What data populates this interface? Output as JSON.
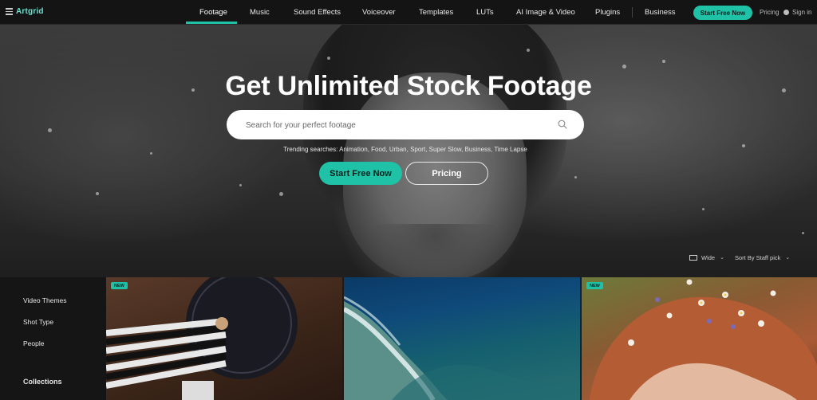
{
  "nav": {
    "logo": "Artgrid",
    "items": [
      {
        "label": "Footage"
      },
      {
        "label": "Music"
      },
      {
        "label": "Sound Effects"
      },
      {
        "label": "Voiceover"
      },
      {
        "label": "Templates"
      },
      {
        "label": "LUTs"
      },
      {
        "label": "AI Image & Video"
      },
      {
        "label": "Plugins"
      }
    ],
    "business": "Business",
    "cta": "Start Free Now",
    "pricing": "Pricing",
    "signin": "Sign in"
  },
  "hero": {
    "title": "Get Unlimited Stock Footage",
    "search_placeholder": "Search for your perfect footage",
    "trending": "Trending searches: Animation, Food, Urban, Sport, Super Slow, Business, Time Lapse",
    "start_button": "Start Free Now",
    "pricing_button": "Pricing"
  },
  "view": {
    "wide": "Wide",
    "sort": "Sort By Staff pick"
  },
  "sidebar": {
    "items": [
      {
        "label": "Video Themes"
      },
      {
        "label": "Shot Type"
      },
      {
        "label": "People"
      }
    ],
    "collections": "Collections"
  },
  "grid": {
    "badge": "NEW"
  },
  "colors": {
    "accent": "#1fc2a6",
    "nav_bg": "#141414",
    "logo": "#6fe0cf"
  }
}
